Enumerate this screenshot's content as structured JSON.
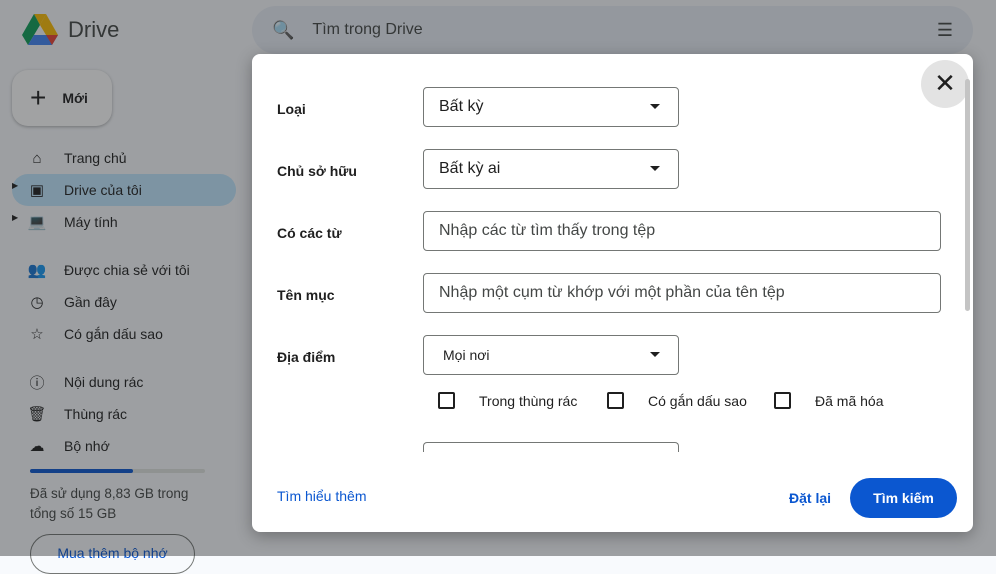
{
  "app": {
    "title": "Drive"
  },
  "sidebar": {
    "new_label": "Mới",
    "items": [
      {
        "label": "Trang chủ",
        "icon": "home-icon"
      },
      {
        "label": "Drive của tôi",
        "icon": "my-drive-icon",
        "active": true
      },
      {
        "label": "Máy tính",
        "icon": "computer-icon"
      },
      {
        "label": "Được chia sẻ với tôi",
        "icon": "shared-icon"
      },
      {
        "label": "Gần đây",
        "icon": "clock-icon"
      },
      {
        "label": "Có gắn dấu sao",
        "icon": "star-icon"
      },
      {
        "label": "Nội dung rác",
        "icon": "spam-icon"
      },
      {
        "label": "Thùng rác",
        "icon": "trash-icon"
      },
      {
        "label": "Bộ nhớ",
        "icon": "cloud-icon"
      }
    ],
    "storage": {
      "used_percent": 58.9,
      "text": "Đã sử dụng 8,83 GB trong tổng số 15 GB",
      "buy_label": "Mua thêm bộ nhớ"
    }
  },
  "search": {
    "placeholder": "Tìm trong Drive"
  },
  "dialog": {
    "type_label": "Loại",
    "type_value": "Bất kỳ",
    "owner_label": "Chủ sở hữu",
    "owner_value": "Bất kỳ ai",
    "words_label": "Có các từ",
    "words_placeholder": "Nhập các từ tìm thấy trong tệp",
    "name_label": "Tên mục",
    "name_placeholder": "Nhập một cụm từ khớp với một phần của tên tệp",
    "location_label": "Địa điểm",
    "location_value": "Mọi nơi",
    "checkboxes": [
      {
        "label": "Trong thùng rác",
        "checked": false
      },
      {
        "label": "Có gắn dấu sao",
        "checked": false
      },
      {
        "label": "Đã mã hóa",
        "checked": false
      }
    ],
    "learn_more": "Tìm hiểu thêm",
    "reset": "Đặt lại",
    "search": "Tìm kiếm"
  }
}
